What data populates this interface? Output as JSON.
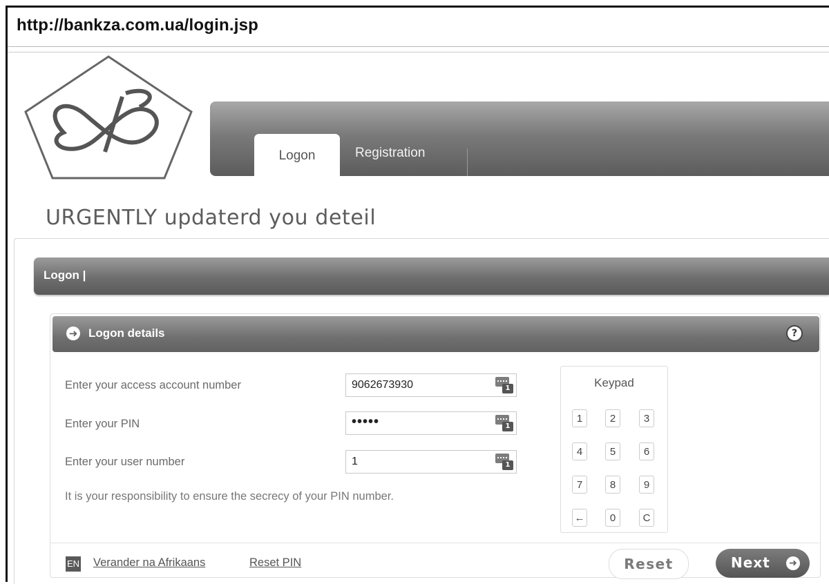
{
  "address_bar": {
    "url": "http://bankza.com.ua/login.jsp"
  },
  "logo": {
    "icon": "bank-monogram-logo"
  },
  "nav": {
    "tabs": [
      {
        "label": "Logon",
        "active": true
      },
      {
        "label": "Registration",
        "active": false
      }
    ]
  },
  "headline": "URGENTLY updaterd you deteil",
  "section": {
    "title": "Logon  |"
  },
  "panel": {
    "title": "Logon details",
    "help_symbol": "?",
    "fields": [
      {
        "label": "Enter your access account number",
        "value": "9062673930"
      },
      {
        "label": "Enter your PIN",
        "value": "•••••"
      },
      {
        "label": "Enter your user number",
        "value": "1"
      }
    ],
    "notice": "It is your responsibility to ensure the secrecy of your PIN number.",
    "keypad": {
      "title": "Keypad",
      "keys": [
        "1",
        "2",
        "3",
        "4",
        "5",
        "6",
        "7",
        "8",
        "9",
        "←",
        "0",
        "C"
      ]
    }
  },
  "footer": {
    "lang_badge": "EN",
    "links": [
      "Verander na Afrikaans",
      "Reset PIN"
    ],
    "reset_label": "Reset",
    "next_label": "Next"
  },
  "colors": {
    "bar_dark": "#5c5c5c",
    "bar_light": "#a8a8a8",
    "text": "#555555"
  },
  "icons": {
    "panel_arrow": "arrow-circle-right-icon",
    "help": "help-icon",
    "field_keyboard": "keyboard-icon"
  }
}
